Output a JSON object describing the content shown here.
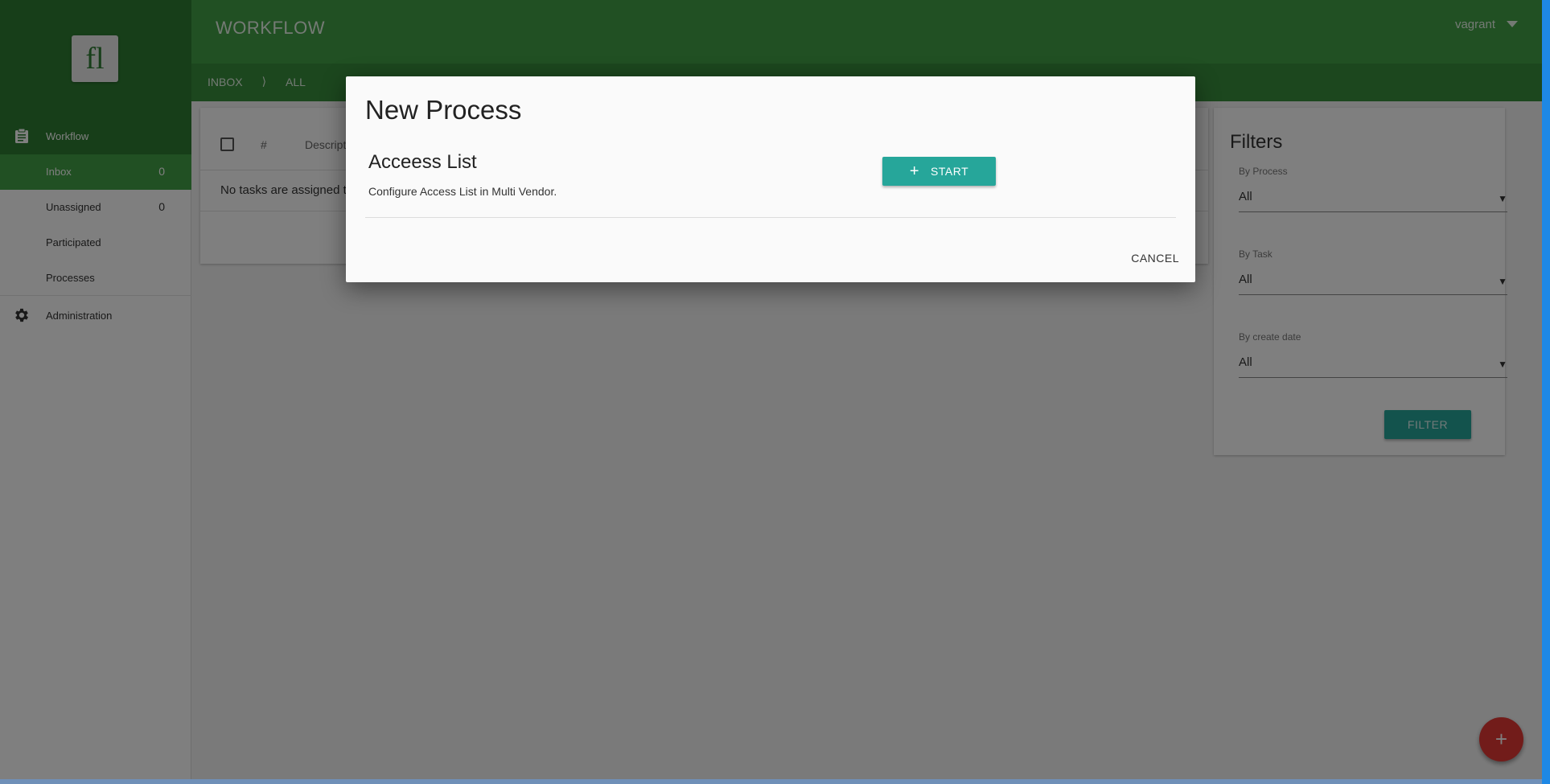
{
  "sidebar": {
    "logo_text": "fl",
    "workflow_label": "Workflow",
    "items": [
      {
        "label": "Inbox",
        "count": "0"
      },
      {
        "label": "Unassigned",
        "count": "0"
      },
      {
        "label": "Participated"
      },
      {
        "label": "Processes"
      }
    ],
    "admin_label": "Administration"
  },
  "header": {
    "title": "WORKFLOW",
    "user": "vagrant"
  },
  "breadcrumb": {
    "root": "INBOX",
    "separator": "⟩",
    "current": "ALL"
  },
  "tasks": {
    "col_num": "#",
    "col_desc": "Description",
    "empty_message": "No tasks are assigned to you"
  },
  "filters": {
    "title": "Filters",
    "groups": [
      {
        "label": "By Process",
        "value": "All"
      },
      {
        "label": "By Task",
        "value": "All"
      },
      {
        "label": "By create date",
        "value": "All"
      }
    ],
    "button_label": "FILTER"
  },
  "fab_label": "+",
  "dialog": {
    "title": "New Process",
    "process": {
      "name": "Acceess List",
      "description": "Configure Access List in Multi Vendor.",
      "start_label": "START"
    },
    "cancel_label": "CANCEL"
  },
  "colors": {
    "primary": "#43a047",
    "primary_dark": "#2e7d32",
    "accent": "#26a69a",
    "fab": "#e53935"
  }
}
